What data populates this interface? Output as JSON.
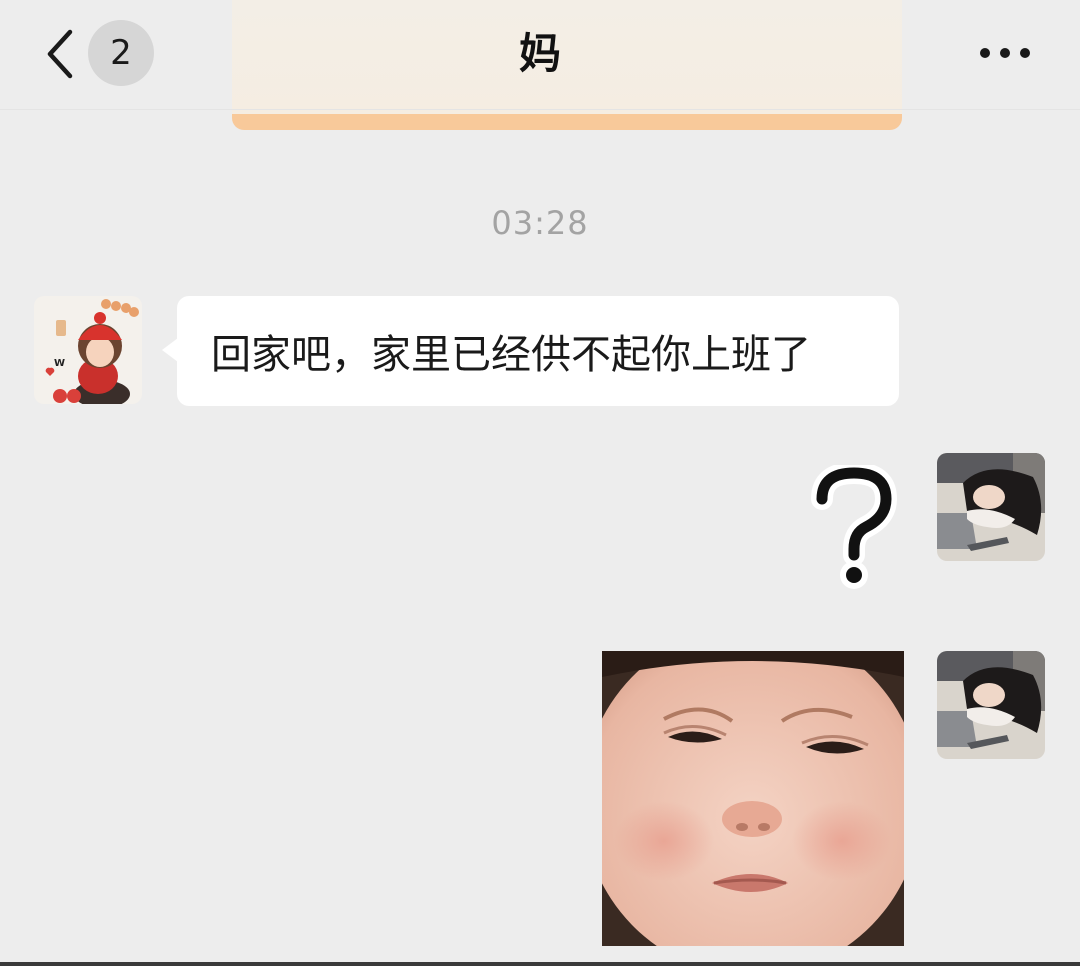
{
  "header": {
    "back_icon": "chevron-left-icon",
    "unread_count": "2",
    "title": "妈",
    "more_icon": "ellipsis-icon"
  },
  "chat": {
    "timestamp": "03:28",
    "messages": [
      {
        "sender": "mom",
        "type": "text",
        "text": "回家吧，家里已经供不起你上班了"
      },
      {
        "sender": "me",
        "type": "sticker",
        "sticker": "question-mark-sticker"
      },
      {
        "sender": "me",
        "type": "sticker",
        "sticker": "sad-baby-face-sticker"
      }
    ]
  },
  "colors": {
    "background": "#ededed",
    "bubble": "#ffffff",
    "banner_accent": "#f8c99a",
    "timestamp": "#a3a3a3"
  }
}
